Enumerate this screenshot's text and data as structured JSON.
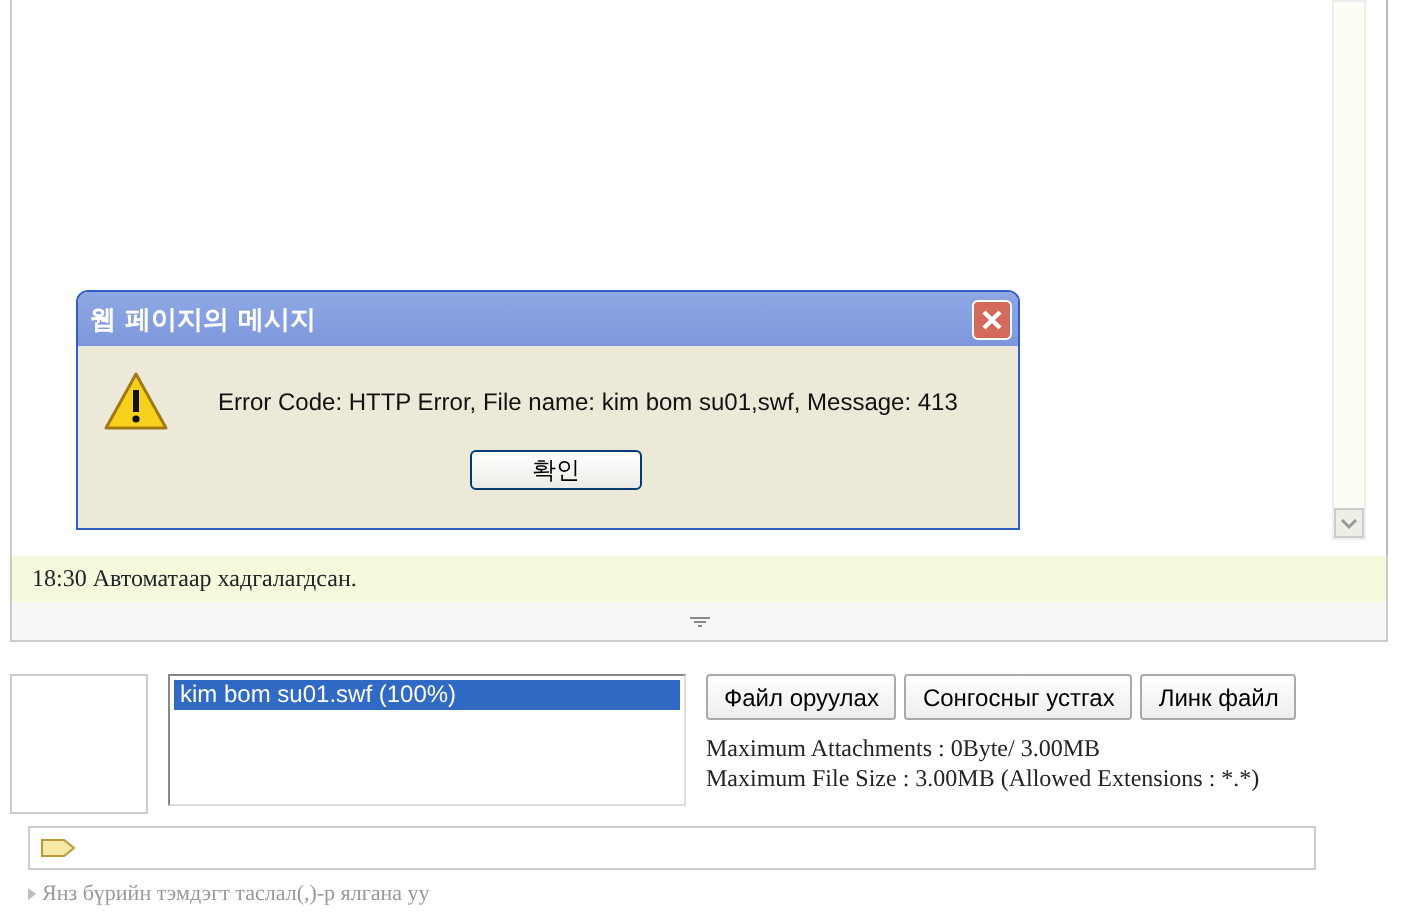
{
  "dialog": {
    "title": "웹 페이지의 메시지",
    "message": "Error Code: HTTP Error, File name: kim bom su01,swf, Message: 413",
    "ok_button": "확인"
  },
  "status": {
    "text": "18:30 Автоматаар хадгалагдсан."
  },
  "upload": {
    "files": [
      {
        "name": "kim bom su01.swf (100%)",
        "selected": true
      }
    ],
    "buttons": [
      "Файл оруулах",
      "Сонгосныг устгах",
      "Линк файл"
    ],
    "info": [
      "Maximum Attachments : 0Byte/ 3.00MB",
      "Maximum File Size : 3.00MB (Allowed Extensions : *.*)"
    ]
  },
  "tags": {
    "hint": "Янз бүрийн тэмдэгт таслал(,)-р ялгана уу"
  }
}
